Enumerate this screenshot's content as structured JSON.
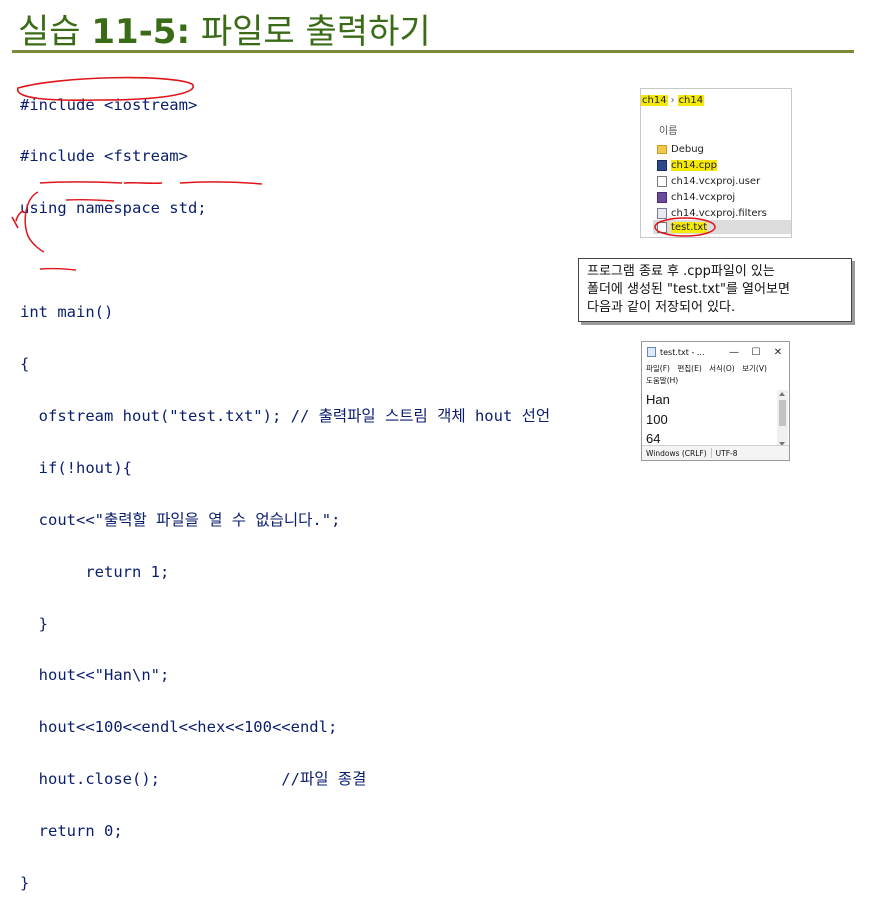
{
  "slide": {
    "title_prefix": "실습 ",
    "title_number": "11-5:",
    "title_text": " 파일로 출력하기"
  },
  "code_lines": [
    "#include <iostream>",
    "#include <fstream>",
    "using namespace std;",
    "",
    "int main()",
    "{",
    "  ofstream hout(\"test.txt\"); // 출력파일 스트림 객체 hout 선언",
    "  if(!hout){",
    "  cout<<\"출력할 파일을 열 수 없습니다.\";",
    "       return 1;",
    "  }",
    "  hout<<\"Han\\n\";",
    "  hout<<100<<endl<<hex<<100<<endl;",
    "  hout.close();             //파일 종결",
    "  return 0;",
    "}"
  ],
  "explorer": {
    "breadcrumb": [
      "ch14",
      "ch14"
    ],
    "column_header": "이름",
    "files": [
      {
        "name": "Debug",
        "icon": "folder-icon",
        "highlighted": false,
        "selected": false
      },
      {
        "name": "ch14.cpp",
        "icon": "cpp-file-icon",
        "highlighted": true,
        "selected": false
      },
      {
        "name": "ch14.vcxproj.user",
        "icon": "user-file-icon",
        "highlighted": false,
        "selected": false
      },
      {
        "name": "ch14.vcxproj",
        "icon": "vcxproj-file-icon",
        "highlighted": false,
        "selected": false
      },
      {
        "name": "ch14.vcxproj.filters",
        "icon": "filters-file-icon",
        "highlighted": false,
        "selected": false
      },
      {
        "name": "test.txt",
        "icon": "text-file-icon",
        "highlighted": true,
        "selected": true
      }
    ]
  },
  "callout": {
    "lines": [
      "프로그램 종료 후 .cpp파일이 있는",
      "폴더에 생성된 \"test.txt\"를 열어보면",
      "다음과 같이 저장되어 있다."
    ]
  },
  "notepad": {
    "title": "test.txt - ...",
    "minimize": "—",
    "maximize": "☐",
    "close": "✕",
    "menu": [
      "파일(F)",
      "편집(E)",
      "서식(O)",
      "보기(V)"
    ],
    "menu_second_row": "도움말(H)",
    "content_lines": [
      "Han",
      "100",
      "64"
    ],
    "status": [
      "Windows (CRLF)",
      "UTF-8"
    ]
  },
  "colors": {
    "title": "#3a6b17",
    "code": "#0a1e6e",
    "annotation": "#e0151b",
    "highlight": "#f5e90c"
  }
}
